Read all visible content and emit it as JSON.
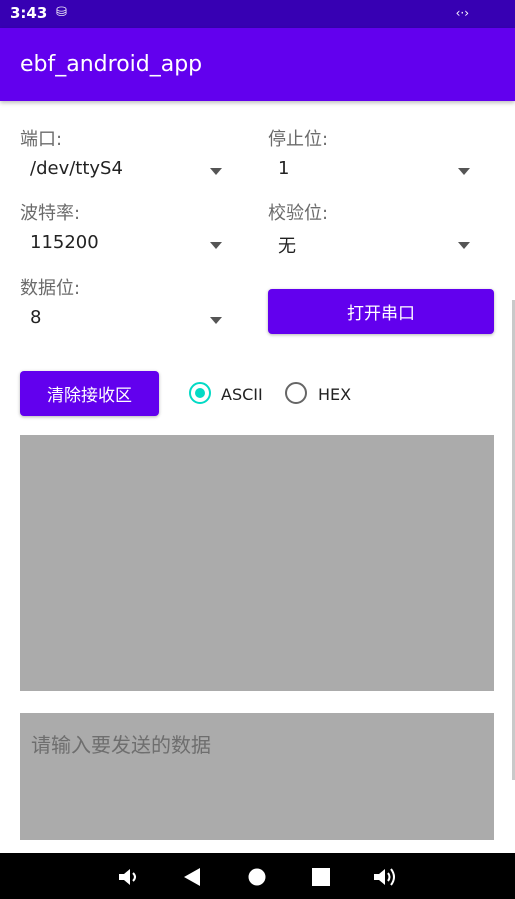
{
  "status_bar": {
    "time": "3:43",
    "left_icon": "sim-icon",
    "right_icon": "vpn-key-icon",
    "left_glyph": "⛁",
    "right_glyph": "‹·›"
  },
  "app_bar": {
    "title": "ebf_android_app"
  },
  "form": {
    "port_label": "端口:",
    "port_value": "/dev/ttyS4",
    "stop_bits_label": "停止位:",
    "stop_bits_value": "1",
    "baud_label": "波特率:",
    "baud_value": "115200",
    "parity_label": "校验位:",
    "parity_value": "无",
    "data_bits_label": "数据位:",
    "data_bits_value": "8",
    "open_button": "打开串口"
  },
  "receive": {
    "clear_button": "清除接收区",
    "mode_ascii": "ASCII",
    "mode_hex": "HEX",
    "selected_mode": "ASCII"
  },
  "send": {
    "placeholder": "请输入要发送的数据"
  },
  "nav_bar": {
    "icons": [
      "volume-down-icon",
      "back-icon",
      "home-icon",
      "recents-icon",
      "volume-up-icon"
    ]
  },
  "colors": {
    "status_bar": "#3700b3",
    "primary": "#6200ee",
    "accent": "#03dac5",
    "text_area_bg": "#ababab"
  }
}
